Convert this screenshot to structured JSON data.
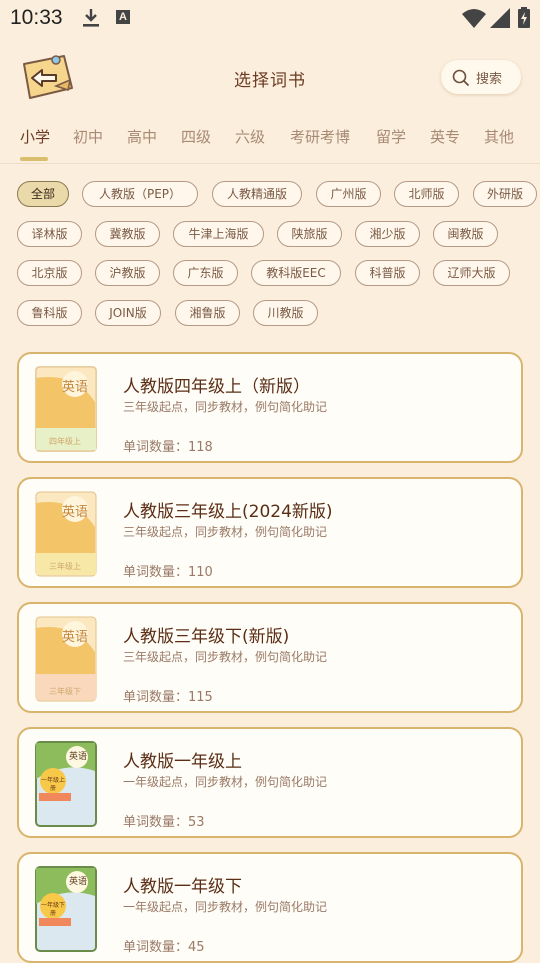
{
  "status_bar": {
    "time": "10:33",
    "a_icon_label": "A"
  },
  "header": {
    "title": "选择词书",
    "search_label": "搜索"
  },
  "tabs": [
    "小学",
    "初中",
    "高中",
    "四级",
    "六级",
    "考研考博",
    "留学",
    "英专",
    "其他"
  ],
  "active_tab": "小学",
  "filters": [
    "全部",
    "人教版（PEP）",
    "人教精通版",
    "广州版",
    "北师版",
    "外研版",
    "译林版",
    "冀教版",
    "牛津上海版",
    "陕旅版",
    "湘少版",
    "闽教版",
    "北京版",
    "沪教版",
    "广东版",
    "教科版EEC",
    "科普版",
    "辽师大版",
    "鲁科版",
    "JOIN版",
    "湘鲁版",
    "川教版"
  ],
  "active_filter": "全部",
  "books": [
    {
      "title": "人教版四年级上（新版）",
      "desc": "三年级起点，同步教材，例句简化助记",
      "count": "单词数量：118",
      "cover_title": "英语",
      "cover_grade": "四年级上",
      "cover_style": "peach"
    },
    {
      "title": "人教版三年级上(2024新版)",
      "desc": "三年级起点，同步教材，例句简化助记",
      "count": "单词数量：110",
      "cover_title": "英语",
      "cover_grade": "三年级上",
      "cover_style": "peach"
    },
    {
      "title": "人教版三年级下(新版)",
      "desc": "三年级起点，同步教材，例句简化助记",
      "count": "单词数量：115",
      "cover_title": "英语",
      "cover_grade": "三年级下",
      "cover_style": "peach"
    },
    {
      "title": "人教版一年级上",
      "desc": "一年级起点，同步教材，例句简化助记",
      "count": "单词数量：53",
      "cover_title": "英语",
      "cover_grade": "一年级上册",
      "cover_style": "green"
    },
    {
      "title": "人教版一年级下",
      "desc": "一年级起点，同步教材，例句简化助记",
      "count": "单词数量：45",
      "cover_title": "英语",
      "cover_grade": "一年级下册",
      "cover_style": "green"
    }
  ],
  "colors": {
    "background": "#fbeedd",
    "card_border": "#d9b46d",
    "accent": "#d9bf6e",
    "title_text": "#5a2d14"
  }
}
